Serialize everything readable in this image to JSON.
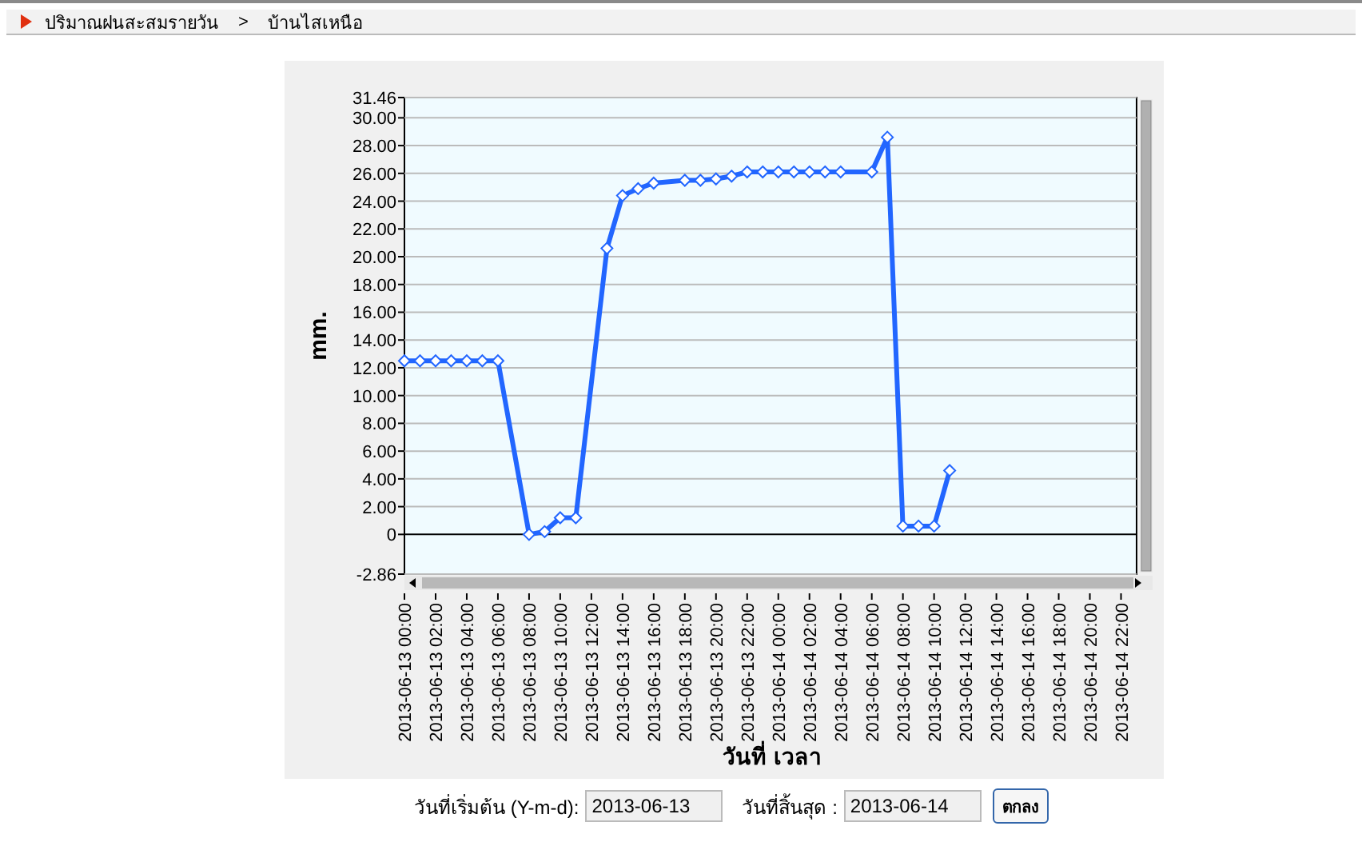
{
  "breadcrumb": {
    "items": [
      "ปริมาณฝนสะสมรายวัน",
      "บ้านไสเหนือ"
    ],
    "separator": ">"
  },
  "chart": {
    "chart_data": {
      "type": "line",
      "xlabel": "วันที่ เวลา",
      "ylabel": "mm.",
      "categories": [
        "2013-06-13 00:00",
        null,
        "2013-06-13 02:00",
        null,
        "2013-06-13 04:00",
        null,
        "2013-06-13 06:00",
        null,
        "2013-06-13 08:00",
        null,
        "2013-06-13 10:00",
        null,
        "2013-06-13 12:00",
        null,
        "2013-06-13 14:00",
        null,
        "2013-06-13 16:00",
        null,
        "2013-06-13 18:00",
        null,
        "2013-06-13 20:00",
        null,
        "2013-06-13 22:00",
        null,
        "2013-06-14 00:00",
        null,
        "2013-06-14 02:00",
        null,
        "2013-06-14 04:00",
        null,
        "2013-06-14 06:00",
        null,
        "2013-06-14 08:00",
        null,
        "2013-06-14 10:00",
        null,
        "2013-06-14 12:00",
        null,
        "2013-06-14 14:00",
        null,
        "2013-06-14 16:00",
        null,
        "2013-06-14 18:00",
        null,
        "2013-06-14 20:00",
        null,
        "2013-06-14 22:00"
      ],
      "series": [
        {
          "color": "#2266ff",
          "marker": "diamond",
          "values": [
            12.5,
            12.5,
            12.5,
            12.5,
            12.5,
            12.5,
            12.5,
            null,
            0,
            0.2,
            1.2,
            1.2,
            null,
            20.6,
            24.4,
            24.9,
            25.3,
            null,
            25.5,
            25.5,
            25.6,
            25.8,
            26.1,
            26.1,
            26.1,
            26.1,
            26.1,
            26.1,
            26.1,
            null,
            26.1,
            28.6,
            0.6,
            0.6,
            0.6,
            4.6,
            null,
            null,
            null,
            null,
            null,
            null,
            null,
            null,
            null,
            null,
            null
          ]
        }
      ],
      "ylim": [
        -2.86,
        31.46
      ],
      "grid": true,
      "yticks": [
        {
          "value": -2.86,
          "label": "-2.86"
        },
        {
          "value": 0,
          "label": "0"
        },
        {
          "value": 2,
          "label": "2.00"
        },
        {
          "value": 4,
          "label": "4.00"
        },
        {
          "value": 6,
          "label": "6.00"
        },
        {
          "value": 8,
          "label": "8.00"
        },
        {
          "value": 10,
          "label": "10.00"
        },
        {
          "value": 12,
          "label": "12.00"
        },
        {
          "value": 14,
          "label": "14.00"
        },
        {
          "value": 16,
          "label": "16.00"
        },
        {
          "value": 18,
          "label": "18.00"
        },
        {
          "value": 20,
          "label": "20.00"
        },
        {
          "value": 22,
          "label": "22.00"
        },
        {
          "value": 24,
          "label": "24.00"
        },
        {
          "value": 26,
          "label": "26.00"
        },
        {
          "value": 28,
          "label": "28.00"
        },
        {
          "value": 30,
          "label": "30.00"
        },
        {
          "value": 31.46,
          "label": "31.46"
        }
      ]
    }
  },
  "form": {
    "start_label": "วันที่เริ่มต้น (Y-m-d):",
    "start_value": "2013-06-13",
    "end_label": "วันที่สิ้นสุด :",
    "end_value": "2013-06-14",
    "submit": "ตกลง"
  }
}
